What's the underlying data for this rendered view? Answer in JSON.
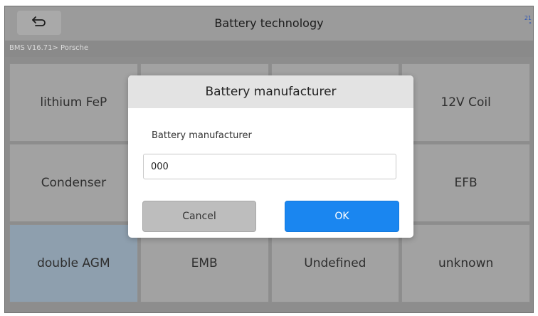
{
  "header": {
    "title": "Battery technology",
    "status_text": [
      "21",
      "°"
    ]
  },
  "breadcrumb": "BMS V16.71> Porsche",
  "options": [
    {
      "label": "lithium FeP"
    },
    {
      "label": ""
    },
    {
      "label": ""
    },
    {
      "label": "12V Coil"
    },
    {
      "label": "Condenser"
    },
    {
      "label": ""
    },
    {
      "label": ""
    },
    {
      "label": "EFB"
    },
    {
      "label": "double AGM"
    },
    {
      "label": "EMB"
    },
    {
      "label": "Undefined"
    },
    {
      "label": "unknown"
    }
  ],
  "dialog": {
    "title": "Battery manufacturer",
    "field_label": "Battery manufacturer",
    "input_value": "000",
    "cancel_label": "Cancel",
    "ok_label": "OK"
  },
  "icons": {
    "back": "back-arrow-icon"
  },
  "colors": {
    "accent": "#1a86f0",
    "selected_tile": "#8e9fae"
  }
}
